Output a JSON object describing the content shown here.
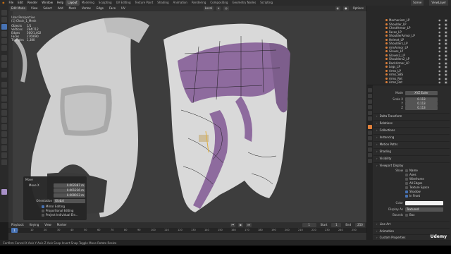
{
  "menu": {
    "items": [
      "File",
      "Edit",
      "Render",
      "Window",
      "Help"
    ],
    "workspaces": [
      "Layout",
      "Modeling",
      "Sculpting",
      "UV Editing",
      "Texture Paint",
      "Shading",
      "Animation",
      "Rendering",
      "Compositing",
      "Geometry Nodes",
      "Scripting"
    ],
    "active_workspace": "Layout",
    "scene_label": "Scene",
    "view_layer_label": "ViewLayer"
  },
  "viewport_header": {
    "mode": "Edit Mode",
    "menus": [
      "View",
      "Select",
      "Add",
      "Mesh",
      "Vertex",
      "Edge",
      "Face",
      "UV"
    ],
    "orientation": "Local",
    "options_label": "Options"
  },
  "overlay": {
    "title": "User Perspective",
    "subtitle": "(1) Chain_1_Mesh",
    "rows": [
      {
        "k": "Objects",
        "v": "1/1"
      },
      {
        "k": "Vertices",
        "v": "284/712"
      },
      {
        "k": "Edges",
        "v": "560/1,402"
      },
      {
        "k": "Faces",
        "v": "276/690"
      },
      {
        "k": "Triangles",
        "v": "1,380"
      }
    ]
  },
  "operator": {
    "title": "Move",
    "move_label": "Move X",
    "x": "0.002387 m",
    "y": "0.001236 m",
    "z": "0.000013 m",
    "orientation_label": "Orientation",
    "orientation_value": "Global",
    "options": [
      {
        "label": "Mirror Editing",
        "on": true
      },
      {
        "label": "Proportional Editing",
        "on": false
      },
      {
        "label": "Project Individual Ele...",
        "on": false
      }
    ]
  },
  "outliner": {
    "items": [
      "Mechanism_LP",
      "Shoulder_LP",
      "ChestArmor_LP",
      "Faces_LP",
      "ShoulderArmor_LP",
      "Helmet_LP",
      "Shoulders_LP",
      "ArmArmor_LP",
      "Gloves_LP",
      "Gloves2_LP",
      "Shoulders2_LP",
      "BackArmor_LP",
      "Legs_LP",
      "Arms_LP",
      "Arms_SBS",
      "Arms_Ret",
      "Arms_Ret"
    ]
  },
  "properties": {
    "mode_label": "Mode",
    "mode_value": "XYZ Euler",
    "scale_labels": [
      "Scale X",
      "Y",
      "Z"
    ],
    "scale_values": [
      "0.113",
      "0.113",
      "0.113"
    ],
    "sections": [
      "Delta Transform",
      "Relations",
      "Collections",
      "Instancing",
      "Motion Paths",
      "Shading",
      "Visibility",
      "Viewport Display"
    ],
    "viewport_display": {
      "show_label": "Show",
      "options": [
        {
          "label": "Name",
          "on": false
        },
        {
          "label": "Axes",
          "on": false
        },
        {
          "label": "Wireframe",
          "on": false
        },
        {
          "label": "All Edges",
          "on": false
        },
        {
          "label": "Texture Space",
          "on": false
        },
        {
          "label": "Shadow",
          "on": true
        },
        {
          "label": "In Front",
          "on": true
        }
      ],
      "color_label": "Color",
      "display_as_label": "Display As",
      "display_as_value": "Textured",
      "bounds_label": "Bounds",
      "bounds_value": "Box"
    },
    "bottom_sections": [
      "Line Art",
      "Animation",
      "Custom Properties"
    ]
  },
  "timeline": {
    "menus": [
      "Playback",
      "Keying",
      "View",
      "Marker"
    ],
    "current_frame": "1",
    "start_label": "Start",
    "start_value": "1",
    "end_label": "End",
    "end_value": "250",
    "ticks": [
      "0",
      "10",
      "20",
      "30",
      "40",
      "50",
      "60",
      "70",
      "80",
      "90",
      "100",
      "110",
      "120",
      "130",
      "140",
      "150",
      "160",
      "170",
      "180",
      "190",
      "200",
      "210",
      "220",
      "230",
      "240",
      "250"
    ]
  },
  "statusbar": {
    "left": "Confirm   Cancel   X Axis   Y Axis   Z Axis   Snap Invert   Snap Toggle   Move   Rotate   Resize",
    "right": "Udemy"
  },
  "colors": {
    "selected_faces": "#8e6b9e",
    "mesh_light": "#dcdcdc",
    "accent": "#4772b3"
  }
}
